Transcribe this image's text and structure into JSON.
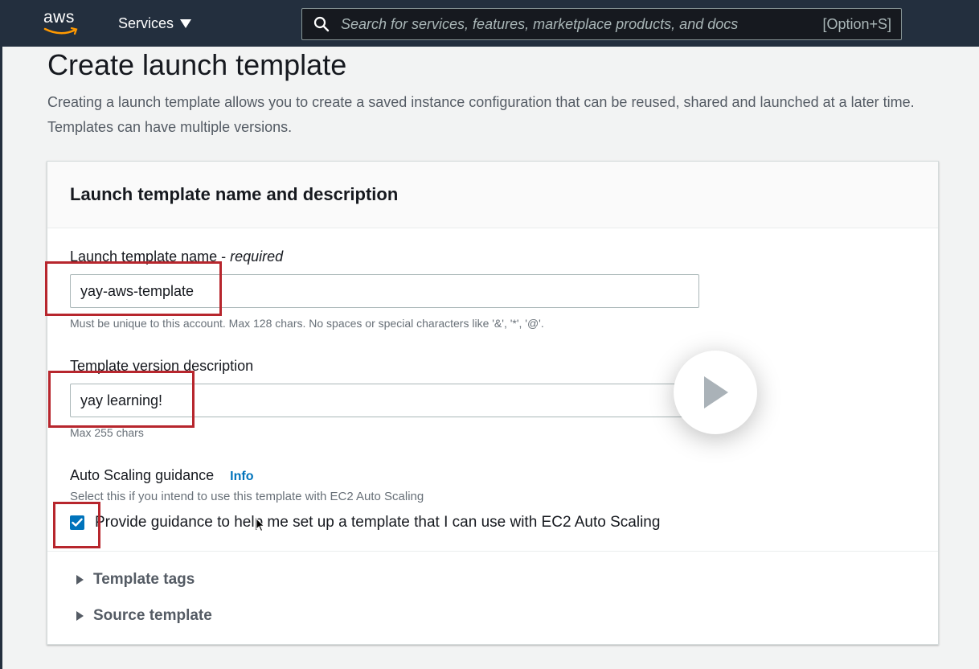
{
  "topbar": {
    "logo_text": "aws",
    "services_label": "Services",
    "search_placeholder": "Search for services, features, marketplace products, and docs",
    "search_shortcut": "[Option+S]"
  },
  "page": {
    "title": "Create launch template",
    "description": "Creating a launch template allows you to create a saved instance configuration that can be reused, shared and launched at a later time. Templates can have multiple versions."
  },
  "panel": {
    "header": "Launch template name and description",
    "name_field": {
      "label": "Launch template name - ",
      "label_required": "required",
      "value": "yay-aws-template",
      "hint": "Must be unique to this account. Max 128 chars. No spaces or special characters like '&', '*', '@'."
    },
    "description_field": {
      "label": "Template version description",
      "value": "yay learning!",
      "hint": "Max 255 chars"
    },
    "autoscaling": {
      "label": "Auto Scaling guidance",
      "info_link": "Info",
      "hint": "Select this if you intend to use this template with EC2 Auto Scaling",
      "checkbox_label": "Provide guidance to help me set up a template that I can use with EC2 Auto Scaling",
      "checked": true
    },
    "expanders": [
      {
        "label": "Template tags"
      },
      {
        "label": "Source template"
      }
    ]
  },
  "colors": {
    "topbar": "#232f3e",
    "accent_blue": "#0073bb",
    "annotation_red": "#b7262d"
  },
  "icons": [
    "aws-logo",
    "caret-down-icon",
    "search-icon",
    "checkmark-icon",
    "caret-right-icon",
    "play-icon",
    "pointer-cursor-icon"
  ]
}
